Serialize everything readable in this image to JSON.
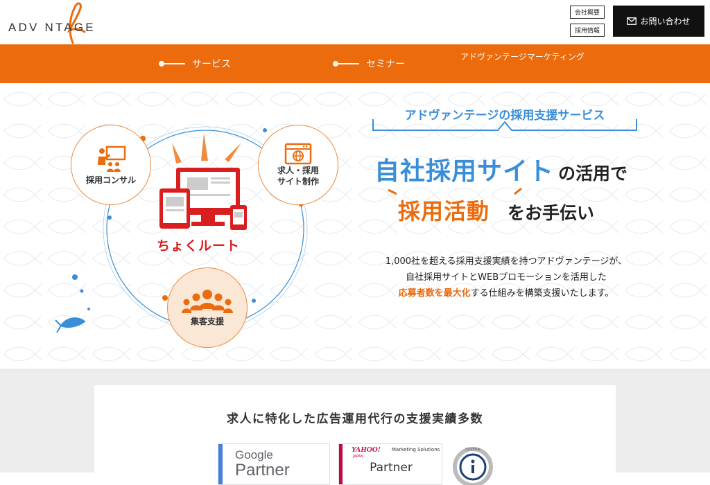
{
  "header": {
    "logo_text": "ADV NTAGE",
    "company_button": "会社概要",
    "recruit_button": "採用情報",
    "contact_button": "お問い合わせ"
  },
  "nav": {
    "service": "サービス",
    "seminar": "セミナー",
    "marketing": "アドヴァンテージマーケティング"
  },
  "hero": {
    "circles": {
      "consult": "採用コンサル",
      "site": "求人・採用\nサイト制作",
      "attract": "集客支援"
    },
    "product_name": "ちょくルート",
    "service_tag": "アドヴァンテージの採用支援サービス",
    "headline1_blue": "自社採用サイト",
    "headline1_dark": "の活用で",
    "headline2_orange": "採用活動",
    "headline2_dark": "をお手伝い",
    "desc_line1": "1,000社を超える採用支援実績を持つアドヴァンテージが、",
    "desc_line2": "自社採用サイトとWEBプロモーションを活用した",
    "desc_line3_highlight": "応募者数を最大化",
    "desc_line3_rest": "する仕組みを構築支援いたします。"
  },
  "partners": {
    "title": "求人に特化した広告運用代行の支援実績多数",
    "google_name": "Google",
    "google_partner": "Partner",
    "yahoo_logo": "YAHOO!",
    "yahoo_japan": "JAPAN",
    "yahoo_sub": "Marketing Solutions",
    "yahoo_partner": "Partner",
    "seal_text": "SILVER★"
  },
  "colors": {
    "brand_orange": "#eb6b0d",
    "brand_blue": "#3a8ed8",
    "brand_red": "#d81e1e"
  }
}
